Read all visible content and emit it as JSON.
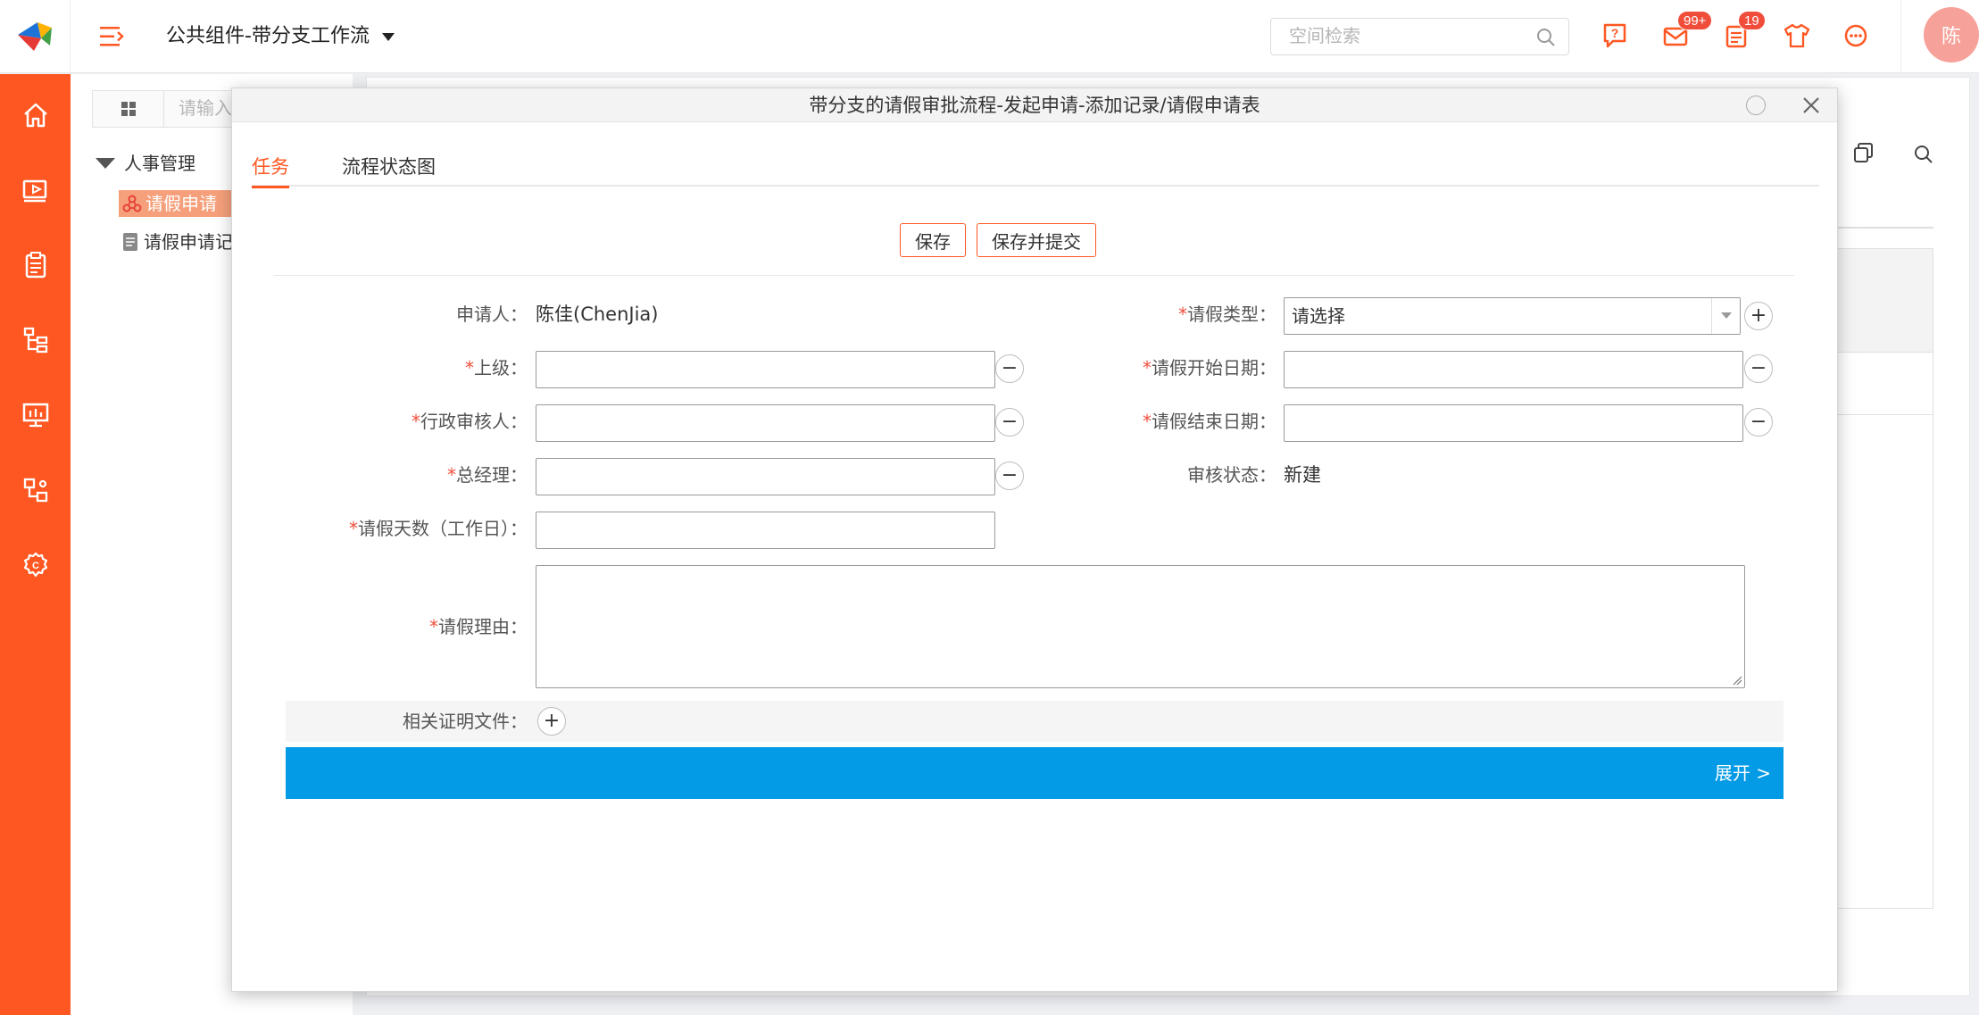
{
  "header": {
    "space_title": "公共组件-带分支工作流",
    "search_placeholder": "空间检索",
    "badges": {
      "messages": "99+",
      "tasks": "19"
    },
    "avatar_text": "陈"
  },
  "tree": {
    "search_placeholder": "请输入",
    "root": "人事管理",
    "items": [
      "请假申请",
      "请假申请记"
    ]
  },
  "modal": {
    "title": "带分支的请假审批流程-发起申请-添加记录/请假申请表",
    "tabs": [
      "任务",
      "流程状态图"
    ],
    "buttons": {
      "save": "保存",
      "save_submit": "保存并提交"
    },
    "form": {
      "applicant_label": "申请人：",
      "applicant_value": "陈佳(ChenJia)",
      "leave_type_label": "请假类型：",
      "leave_type_value": "请选择",
      "superior_label": "上级：",
      "start_date_label": "请假开始日期：",
      "admin_reviewer_label": "行政审核人：",
      "end_date_label": "请假结束日期：",
      "gm_label": "总经理：",
      "review_status_label": "审核状态：",
      "review_status_value": "新建",
      "days_label": "请假天数（工作日）：",
      "reason_label": "请假理由：",
      "attachment_label": "相关证明文件："
    },
    "expand_label": "展开 >"
  },
  "colors": {
    "accent": "#ff5722",
    "expand_bar": "#039be5",
    "required": "#f04e3b"
  }
}
